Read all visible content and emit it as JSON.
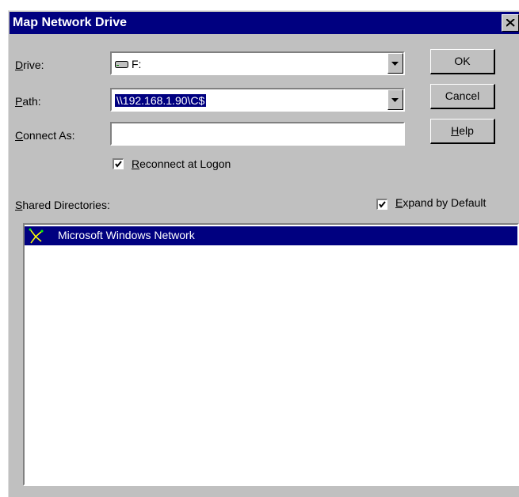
{
  "window": {
    "title": "Map Network Drive",
    "close_glyph": "✕"
  },
  "form": {
    "drive_label": "Drive:",
    "drive_value": "F:",
    "drive_icon": "drive-icon",
    "path_label": "Path:",
    "path_value": "\\\\192.168.1.90\\C$",
    "connect_as_label": "Connect As:",
    "connect_as_value": "",
    "reconnect_label": "Reconnect at Logon",
    "reconnect_checked": true
  },
  "buttons": {
    "ok": "OK",
    "cancel": "Cancel",
    "help": "Help"
  },
  "shared": {
    "label": "Shared Directories:",
    "expand_label": "Expand by Default",
    "expand_checked": true,
    "items": [
      {
        "label": "Microsoft Windows Network",
        "icon": "network-icon",
        "selected": true
      }
    ]
  },
  "colors": {
    "face": "#c0c0c0",
    "title_bar": "#000080",
    "selection": "#000080"
  }
}
